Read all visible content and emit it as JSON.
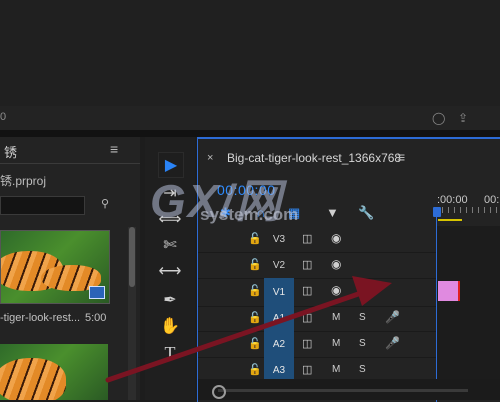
{
  "monitor": {
    "timecode_fragment": "0",
    "icon_export_frame": "camera-icon",
    "icon_export": "export-icon"
  },
  "project": {
    "title": "锈",
    "file_name": "锈.prproj",
    "clip": {
      "name": "-tiger-look-rest...",
      "duration": "5:00"
    }
  },
  "tools": [
    {
      "name": "selection-tool-icon",
      "glyph": "▶",
      "active": true
    },
    {
      "name": "track-select-forward-icon",
      "glyph": "⇥",
      "active": false
    },
    {
      "name": "ripple-edit-tool-icon",
      "glyph": "⟺",
      "active": false
    },
    {
      "name": "razor-tool-icon",
      "glyph": "✄",
      "active": false
    },
    {
      "name": "slip-tool-icon",
      "glyph": "⟷",
      "active": false
    },
    {
      "name": "pen-tool-icon",
      "glyph": "✒",
      "active": false
    },
    {
      "name": "hand-tool-icon",
      "glyph": "✋",
      "active": false
    },
    {
      "name": "type-tool-icon",
      "glyph": "T",
      "active": false
    }
  ],
  "timeline": {
    "close_label": "×",
    "title": "Big-cat-tiger-look-rest_1366x768",
    "menu_label": "≡",
    "timecode": "00:00:00",
    "ruler_label": ":00:00",
    "ruler_label_2": "00:",
    "accent_color": "#2d6cd6",
    "tracks": [
      {
        "name": "V3",
        "type": "video",
        "selected": false
      },
      {
        "name": "V2",
        "type": "video",
        "selected": false
      },
      {
        "name": "V1",
        "type": "video",
        "selected": true
      },
      {
        "name": "A1",
        "type": "audio",
        "selected": true
      },
      {
        "name": "A2",
        "type": "audio",
        "selected": true
      },
      {
        "name": "A3",
        "type": "audio",
        "selected": true
      }
    ],
    "audio_mute_label": "M",
    "audio_solo_label": "S",
    "clip_color": "#e08ae0"
  },
  "watermark": {
    "main": "GX/网",
    "sub": "system.com"
  }
}
